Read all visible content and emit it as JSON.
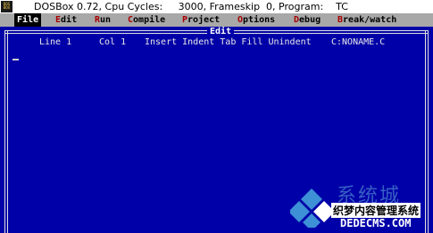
{
  "titlebar": {
    "icon_label": "DOS BOX",
    "title": "DOSBox 0.72, Cpu Cycles:     3000, Frameskip  0, Program:    TC"
  },
  "menu": {
    "items": [
      {
        "hot": "F",
        "rest": "ile"
      },
      {
        "hot": "E",
        "rest": "dit"
      },
      {
        "hot": "R",
        "rest": "un"
      },
      {
        "hot": "C",
        "rest": "ompile"
      },
      {
        "hot": "P",
        "rest": "roject"
      },
      {
        "hot": "O",
        "rest": "ptions"
      },
      {
        "hot": "D",
        "rest": "ebug"
      },
      {
        "hot": "B",
        "rest": "reak/watch"
      }
    ]
  },
  "editor": {
    "title": "Edit",
    "line": "Line 1",
    "col": "Col 1",
    "modes": "Insert Indent Tab Fill Unindent",
    "filename": "C:NONAME.C"
  },
  "watermark": {
    "big": "系统城",
    "line1": "织梦内容管理系统",
    "line2": "DEDECMS.COM"
  },
  "colors": {
    "desktop_blue": "#0000a8",
    "menu_gray": "#a8a8a8",
    "hotkey_red": "#a80000"
  }
}
